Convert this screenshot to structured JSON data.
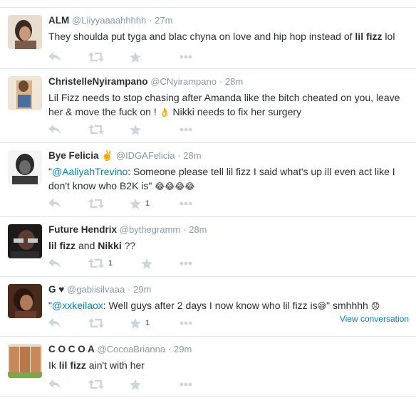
{
  "tweets": [
    {
      "fullname": "ALM",
      "username": "@Liiyyaaaahhhhh",
      "dot": "·",
      "time": "27m",
      "parts": [
        {
          "t": "They shoulda put tyga and blac chyna on love and hip hop instead of "
        },
        {
          "t": "lil fizz",
          "b": true
        },
        {
          "t": " lol"
        }
      ],
      "retweets": "",
      "favorites": ""
    },
    {
      "fullname": "ChristelleNyirampano",
      "username": "@CNyirampano",
      "dot": "·",
      "time": "28m",
      "parts": [
        {
          "t": "Lil Fizz needs to stop chasing after Amanda like the bitch cheated on you, leave her & move the fuck on ! "
        },
        {
          "t": "👌",
          "emoji": true
        },
        {
          "t": " Nikki needs to fix her surgery"
        }
      ],
      "retweets": "",
      "favorites": ""
    },
    {
      "fullname": "Bye Felicia ✌",
      "username": "@IDGAFelicia",
      "dot": "·",
      "time": "28m",
      "parts": [
        {
          "t": "\""
        },
        {
          "t": "@AaliyahTrevino",
          "mention": true
        },
        {
          "t": ": Someone please tell lil fizz I said what's up ill even act like I don't know who B2K is\" "
        },
        {
          "t": "😂😂😂😂",
          "emoji": true
        }
      ],
      "retweets": "",
      "favorites": "1"
    },
    {
      "fullname": "Future Hendrix",
      "username": "@bythegramm",
      "dot": "·",
      "time": "28m",
      "parts": [
        {
          "t": "lil fizz",
          "b": true
        },
        {
          "t": " and "
        },
        {
          "t": "Nikki",
          "b": true
        },
        {
          "t": " ??"
        }
      ],
      "retweets": "1",
      "favorites": ""
    },
    {
      "fullname": "G ♥",
      "username": "@gabiisilvaaa",
      "dot": "·",
      "time": "29m",
      "parts": [
        {
          "t": "\""
        },
        {
          "t": "@xxkeilaox",
          "mention": true
        },
        {
          "t": ": Well guys after 2 days I now know who lil fizz is"
        },
        {
          "t": "😅",
          "emoji": true
        },
        {
          "t": "\" smhhhh "
        },
        {
          "t": "😞",
          "emoji": true
        }
      ],
      "retweets": "",
      "favorites": "1",
      "view_conversation": "View conversation"
    },
    {
      "fullname": "C O C O A",
      "username": "@CocoaBrianna",
      "dot": "·",
      "time": "29m",
      "parts": [
        {
          "t": "Ik "
        },
        {
          "t": "lil fizz",
          "b": true
        },
        {
          "t": " ain't with her"
        }
      ],
      "retweets": "",
      "favorites": ""
    }
  ],
  "icons": {
    "reply": "reply-icon",
    "retweet": "retweet-icon",
    "favorite": "star-icon",
    "more": "more-icon"
  },
  "colors": {
    "link": "#0084b4",
    "muted": "#8899a6",
    "icon": "#ccd6dd",
    "divider": "#e1e8ed"
  }
}
